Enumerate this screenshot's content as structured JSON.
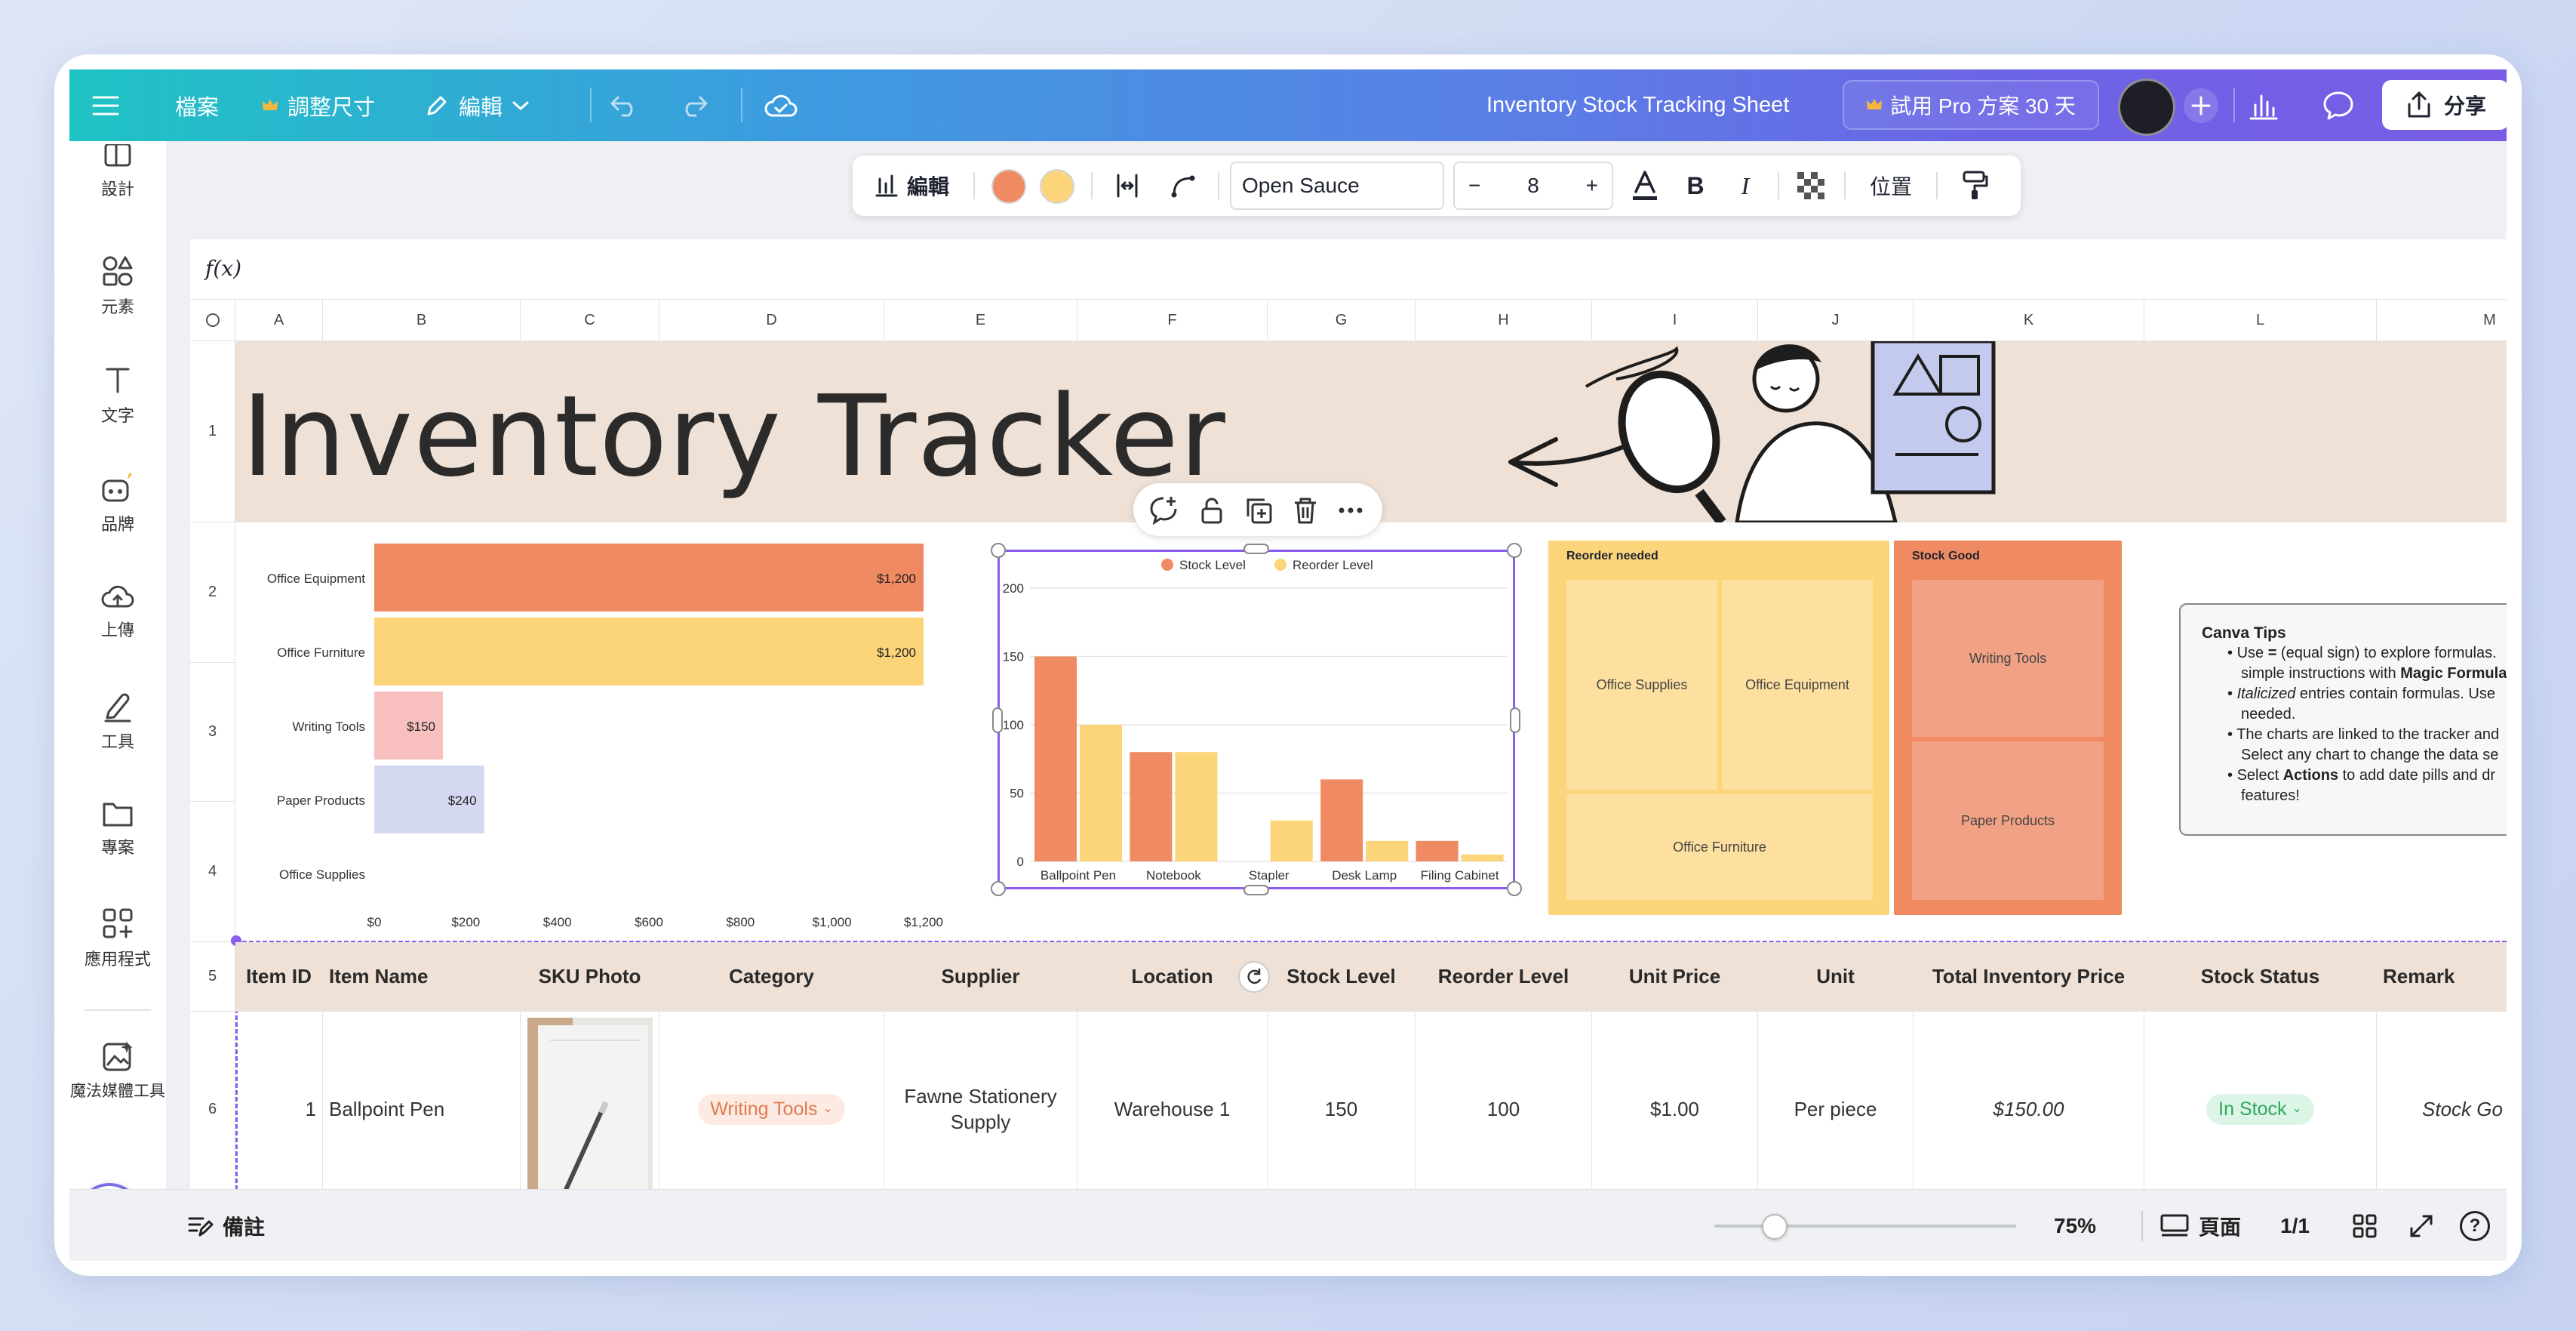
{
  "topbar": {
    "file": "檔案",
    "resize": "調整尺寸",
    "edit": "編輯",
    "doc_title": "Inventory Stock Tracking Sheet",
    "trial": "試用 Pro 方案 30 天",
    "share": "分享"
  },
  "sidebar": {
    "items": [
      {
        "label": "設計",
        "icon": "design-icon"
      },
      {
        "label": "元素",
        "icon": "elements-icon"
      },
      {
        "label": "文字",
        "icon": "text-icon"
      },
      {
        "label": "品牌",
        "icon": "brand-icon"
      },
      {
        "label": "上傳",
        "icon": "upload-icon"
      },
      {
        "label": "工具",
        "icon": "tools-icon"
      },
      {
        "label": "專案",
        "icon": "projects-icon"
      },
      {
        "label": "應用程式",
        "icon": "apps-icon"
      },
      {
        "label": "魔法媒體工具",
        "icon": "magic-media-icon"
      }
    ]
  },
  "format_toolbar": {
    "edit": "編輯",
    "color1": "#ef8a62",
    "color2": "#fcd57a",
    "font": "Open Sauce",
    "font_size": "8",
    "minus": "−",
    "plus": "+",
    "bold": "B",
    "italic": "I",
    "position": "位置"
  },
  "sheet": {
    "formula": "f(x)",
    "columns": [
      "A",
      "B",
      "C",
      "D",
      "E",
      "F",
      "G",
      "H",
      "I",
      "J",
      "K",
      "L",
      "M"
    ],
    "rows": [
      "1",
      "2",
      "3",
      "4",
      "5",
      "6"
    ],
    "title": "Inventory Tracker",
    "headers": [
      "Item ID",
      "Item Name",
      "SKU Photo",
      "Category",
      "Supplier",
      "Location",
      "Stock Level",
      "Reorder Level",
      "Unit Price",
      "Unit",
      "Total Inventory Price",
      "Stock Status",
      "Remark"
    ],
    "row6": {
      "id": "1",
      "name": "Ballpoint Pen",
      "category": "Writing Tools",
      "supplier": "Fawne Stationery Supply",
      "location": "Warehouse 1",
      "stock": "150",
      "reorder": "100",
      "price": "$1.00",
      "unit": "Per piece",
      "total": "$150.00",
      "status": "In Stock",
      "remark": "Stock Go"
    }
  },
  "chart_data": [
    {
      "type": "bar",
      "orientation": "horizontal",
      "categories": [
        "Office Equipment",
        "Office Furniture",
        "Writing Tools",
        "Paper Products",
        "Office Supplies"
      ],
      "values": [
        1200,
        1200,
        150,
        240,
        0
      ],
      "value_labels": [
        "$1,200",
        "$1,200",
        "$150",
        "$240",
        ""
      ],
      "colors": [
        "#ef8a62",
        "#fcd57a",
        "#f7bfbd",
        "#d4d8f0",
        "#d4d8f0"
      ],
      "xlim": [
        0,
        1200
      ],
      "xticks": [
        "$0",
        "$200",
        "$400",
        "$600",
        "$800",
        "$1,000",
        "$1,200"
      ]
    },
    {
      "type": "bar",
      "categories": [
        "Ballpoint Pen",
        "Notebook",
        "Stapler",
        "Desk Lamp",
        "Filing Cabinet"
      ],
      "series": [
        {
          "name": "Stock Level",
          "values": [
            150,
            80,
            0,
            60,
            15
          ],
          "color": "#ef8a62"
        },
        {
          "name": "Reorder Level",
          "values": [
            100,
            80,
            30,
            15,
            5
          ],
          "color": "#fcd57a"
        }
      ],
      "ylim": [
        0,
        200
      ],
      "yticks": [
        "0",
        "50",
        "100",
        "150",
        "200"
      ],
      "legend": "top"
    },
    {
      "type": "treemap",
      "groups": [
        {
          "name": "Reorder needed",
          "color": "#fcd57a",
          "items": [
            "Office Supplies",
            "Office Equipment",
            "Office Furniture"
          ]
        },
        {
          "name": "Stock Good",
          "color": "#ef8a62",
          "items": [
            "Writing Tools",
            "Paper Products"
          ]
        }
      ]
    }
  ],
  "tips": {
    "title": "Canva Tips",
    "items": [
      {
        "pre": "Use ",
        "bold": "=",
        "post": " (equal sign) to explore formulas."
      },
      {
        "pre": "simple instructions with ",
        "bold": "Magic Formula",
        "post": ""
      },
      {
        "pre": "",
        "italic": "Italicized",
        "post": " entries contain formulas. Use"
      },
      {
        "pre": "needed.",
        "post": ""
      },
      {
        "pre": "The charts are linked to the tracker and",
        "post": ""
      },
      {
        "pre": "Select any chart to change the data se",
        "post": ""
      },
      {
        "pre": "Select ",
        "bold": "Actions",
        "post": " to add date pills and dr"
      },
      {
        "pre": "features!",
        "post": ""
      }
    ]
  },
  "bottombar": {
    "notes": "備註",
    "zoom": "75%",
    "page_label": "頁面",
    "page_count": "1/1",
    "help": "?"
  }
}
